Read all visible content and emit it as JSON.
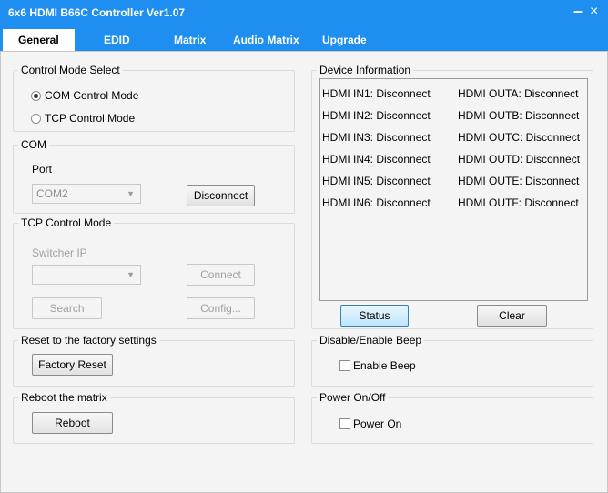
{
  "window": {
    "title": "6x6 HDMI B66C Controller Ver1.07",
    "minimize": "–",
    "close": "×"
  },
  "tabs": [
    "General",
    "EDID",
    "Matrix",
    "Audio Matrix",
    "Upgrade"
  ],
  "control_mode": {
    "legend": "Control Mode Select",
    "options": [
      {
        "label": "COM Control Mode",
        "checked": true
      },
      {
        "label": "TCP Control Mode",
        "checked": false
      }
    ]
  },
  "com": {
    "legend": "COM",
    "port_label": "Port",
    "port_value": "COM2",
    "disconnect_label": "Disconnect"
  },
  "tcp": {
    "legend": "TCP Control Mode",
    "switcher_ip_label": "Switcher IP",
    "ip_value": "",
    "connect_label": "Connect",
    "search_label": "Search",
    "config_label": "Config..."
  },
  "factory": {
    "legend": "Reset to the factory settings",
    "button_label": "Factory Reset"
  },
  "reboot": {
    "legend": "Reboot the matrix",
    "button_label": "Reboot"
  },
  "device_info": {
    "legend": "Device Information",
    "inputs": [
      "HDMI IN1: Disconnect",
      "HDMI IN2: Disconnect",
      "HDMI IN3: Disconnect",
      "HDMI IN4: Disconnect",
      "HDMI IN5: Disconnect",
      "HDMI IN6: Disconnect"
    ],
    "outputs": [
      "HDMI OUTA: Disconnect",
      "HDMI OUTB: Disconnect",
      "HDMI OUTC: Disconnect",
      "HDMI OUTD: Disconnect",
      "HDMI OUTE: Disconnect",
      "HDMI OUTF: Disconnect"
    ],
    "status_label": "Status",
    "clear_label": "Clear"
  },
  "beep": {
    "legend": "Disable/Enable Beep",
    "checkbox_label": "Enable Beep",
    "checked": false
  },
  "power": {
    "legend": "Power On/Off",
    "checkbox_label": "Power On",
    "checked": false
  },
  "colors": {
    "titlebar": "#1e8ff0",
    "panel": "#f4f4f4",
    "border": "#dcdcdc"
  }
}
